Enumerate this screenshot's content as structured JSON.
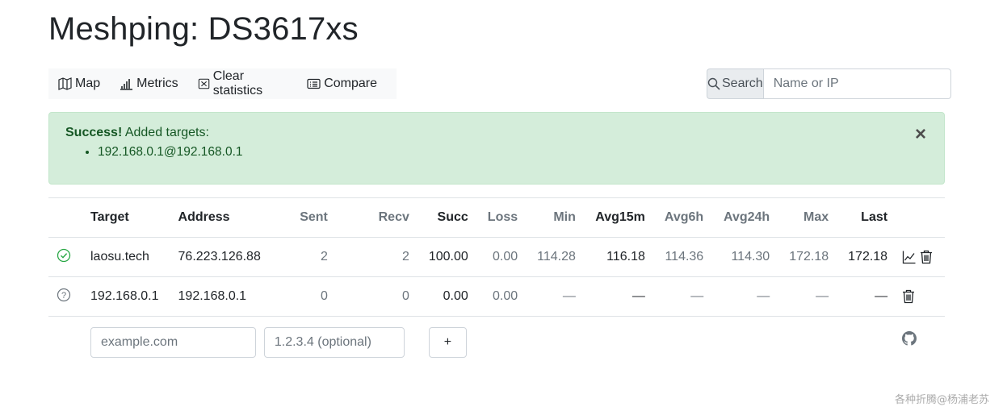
{
  "page": {
    "title": "Meshping: DS3617xs"
  },
  "toolbar": {
    "map_label": "Map",
    "metrics_label": "Metrics",
    "clear_label": "Clear statistics",
    "compare_label": "Compare"
  },
  "search": {
    "label": "Search",
    "placeholder": "Name or IP"
  },
  "alert": {
    "strong": "Success!",
    "message": "Added targets:",
    "items": [
      "192.168.0.1@192.168.0.1"
    ],
    "close_symbol": "×"
  },
  "table": {
    "headers": {
      "target": "Target",
      "address": "Address",
      "sent": "Sent",
      "recv": "Recv",
      "succ": "Succ",
      "loss": "Loss",
      "min": "Min",
      "avg15m": "Avg15m",
      "avg6h": "Avg6h",
      "avg24h": "Avg24h",
      "max": "Max",
      "last": "Last"
    },
    "rows": [
      {
        "status": "ok",
        "target": "laosu.tech",
        "address": "76.223.126.88",
        "sent": "2",
        "recv": "2",
        "succ": "100.00",
        "loss": "0.00",
        "min": "114.28",
        "avg15m": "116.18",
        "avg6h": "114.36",
        "avg24h": "114.30",
        "max": "172.18",
        "last": "172.18"
      },
      {
        "status": "unknown",
        "target": "192.168.0.1",
        "address": "192.168.0.1",
        "sent": "0",
        "recv": "0",
        "succ": "0.00",
        "loss": "0.00",
        "min": "—",
        "avg15m": "—",
        "avg6h": "—",
        "avg24h": "—",
        "max": "—",
        "last": "—"
      }
    ]
  },
  "add_form": {
    "name_placeholder": "example.com",
    "address_placeholder": "1.2.3.4 (optional)",
    "add_label": "+"
  },
  "icons": {
    "status_ok": "check-circle-icon",
    "status_unknown": "question-circle-icon",
    "graph": "graph-icon",
    "delete": "trash-icon",
    "github": "github-icon"
  },
  "colors": {
    "success": "#28a745",
    "alert_bg": "#d4edda",
    "alert_text": "#155724",
    "muted": "#6c757d"
  },
  "watermark": "各种折腾@杨浦老苏"
}
